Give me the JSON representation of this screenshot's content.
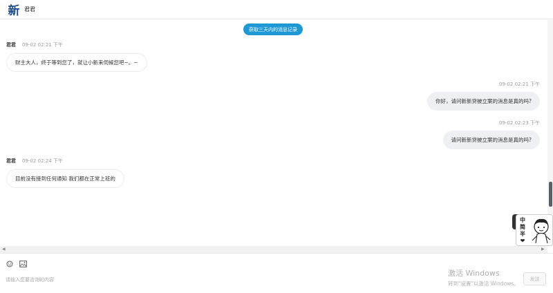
{
  "header": {
    "logo_char": "新",
    "title": "君君"
  },
  "history_button": "获取三天内的消息记录",
  "messages": [
    {
      "side": "left",
      "sender": "君君",
      "time": "09-02 02:21 下午",
      "text": "财主大人，终于等到您了，就让小新来伺候您吧~。~"
    },
    {
      "side": "right",
      "time": "09-02 02:21 下午",
      "text": "你好，请问新新贷被立案的消息是真的吗?"
    },
    {
      "side": "right",
      "time": "09-02 02:23 下午",
      "text": "请问新新贷被立案的消息是真的吗?"
    },
    {
      "side": "left",
      "sender": "君君",
      "time": "09-02 02:24 下午",
      "text": "目前没有接到任何通知 我们都在正常上班的"
    }
  ],
  "sticker": {
    "text": "中简半❤"
  },
  "composer": {
    "icons": [
      "emoji-icon",
      "image-icon"
    ],
    "placeholder": "请输入您要咨询的内容",
    "send_label": "发送"
  },
  "watermark": {
    "line1": "激活 Windows",
    "line2": "转到\"设置\"以激活 Windows。"
  },
  "colors": {
    "accent": "#1f98d6",
    "right_bubble": "#eef0f4"
  }
}
